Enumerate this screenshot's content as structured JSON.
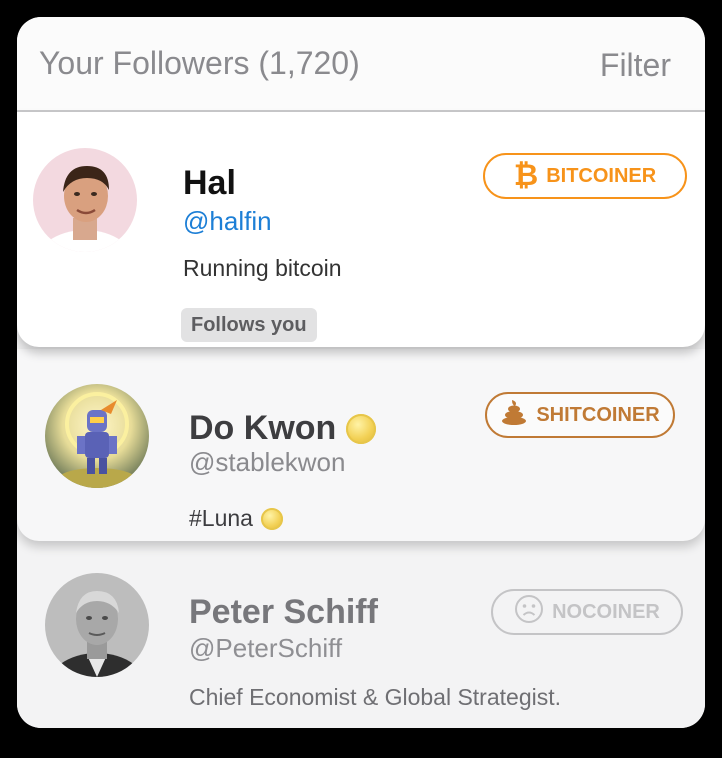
{
  "header": {
    "title": "Your Followers (1,720)",
    "filter_label": "Filter"
  },
  "followers": [
    {
      "name": "Hal",
      "handle": "@halfin",
      "bio": "Running bitcoin",
      "badge": {
        "label": "BITCOINER",
        "icon": "bitcoin-icon",
        "color": "#f7931a"
      },
      "follows_you": "Follows you"
    },
    {
      "name": "Do Kwon",
      "handle": "@stablekwon",
      "bio": "#Luna",
      "badge": {
        "label": "SHITCOINER",
        "icon": "poop-icon",
        "color": "#c07a35"
      }
    },
    {
      "name": "Peter Schiff",
      "handle": "@PeterSchiff",
      "bio": "Chief Economist & Global Strategist.",
      "badge": {
        "label": "NOCOINER",
        "icon": "frown-face-icon",
        "color": "#c4c4c6"
      }
    }
  ]
}
